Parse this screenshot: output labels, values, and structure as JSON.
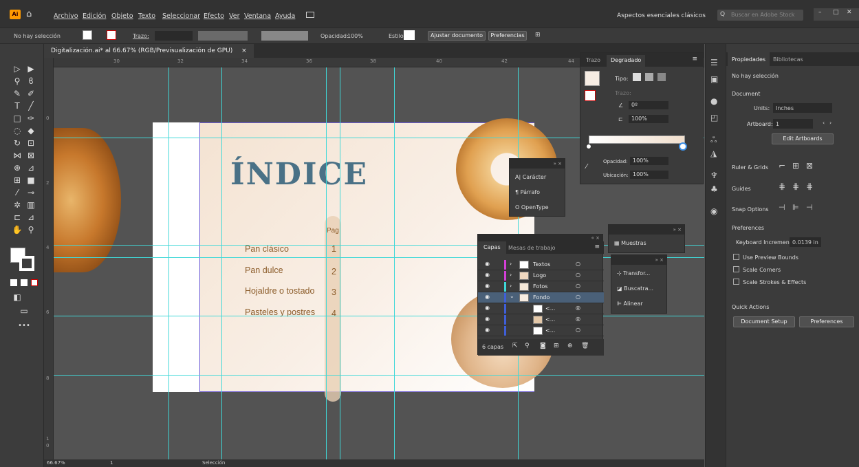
{
  "menubar": {
    "items": [
      "Archivo",
      "Edición",
      "Objeto",
      "Texto",
      "Seleccionar",
      "Efecto",
      "Ver",
      "Ventana",
      "Ayuda"
    ],
    "workspace": "Aspectos esenciales clásicos",
    "search_placeholder": "Buscar en Adobe Stock"
  },
  "control": {
    "selection": "No hay selección",
    "stroke_label": "Trazo:",
    "opacity_label": "Opacidad:",
    "opacity_value": "100%",
    "style_label": "Estilo:",
    "fit_doc": "Ajustar documento",
    "prefs": "Preferencias"
  },
  "document": {
    "tab": "Digitalización.ai* al 66.67% (RGB/Previsualización de GPU)",
    "close": "×"
  },
  "ruler": {
    "h": [
      "30",
      "32",
      "34",
      "36",
      "38",
      "40",
      "42",
      "44"
    ],
    "v": [
      "0",
      "2",
      "4",
      "6",
      "8",
      "1",
      "0"
    ]
  },
  "artboard": {
    "title": "ÍNDICE",
    "pag": "Pag",
    "items": [
      {
        "label": "Pan clásico",
        "num": "1"
      },
      {
        "label": "Pan dulce",
        "num": "2"
      },
      {
        "label": "Hojaldre o tostado",
        "num": "3"
      },
      {
        "label": "Pasteles y postres",
        "num": "4"
      }
    ]
  },
  "gradient_panel": {
    "tab_trazo": "Trazo",
    "tab_degradado": "Degradado",
    "tipo": "Tipo:",
    "trazo": "Trazo:",
    "angle": "0º",
    "aspect": "100%",
    "opacidad_label": "Opacidad:",
    "opacidad": "100%",
    "ubicacion_label": "Ubicación:",
    "ubicacion": "100%"
  },
  "char_panel": {
    "items": [
      "Carácter",
      "Párrafo",
      "OpenType"
    ]
  },
  "swatches_panel": {
    "label": "Muestras"
  },
  "transform_panel": {
    "items": [
      "Transfor...",
      "Buscatra...",
      "Alinear"
    ]
  },
  "layers_panel": {
    "tab_capas": "Capas",
    "tab_mesas": "Mesas de trabajo",
    "layers": [
      {
        "name": "Textos",
        "color": "#d43fd8"
      },
      {
        "name": "Logo",
        "color": "#d43fd8"
      },
      {
        "name": "Fotos",
        "color": "#3fd8d8"
      },
      {
        "name": "Fondo",
        "color": "#3f5fd8"
      },
      {
        "name": "<...",
        "color": "#3f5fd8"
      },
      {
        "name": "<...",
        "color": "#3f5fd8"
      },
      {
        "name": "<...",
        "color": "#3f5fd8"
      }
    ],
    "count": "6 capas"
  },
  "properties": {
    "tab_props": "Propiedades",
    "tab_libs": "Bibliotecas",
    "no_sel": "No hay selección",
    "document": "Document",
    "units_label": "Units:",
    "units": "Inches",
    "artboard_label": "Artboard:",
    "artboard": "1",
    "edit_artboards": "Edit Artboards",
    "ruler_grids": "Ruler & Grids",
    "guides": "Guides",
    "snap": "Snap Options",
    "preferences": "Preferences",
    "keyboard_inc_label": "Keyboard Increment:",
    "keyboard_inc": "0.0139 in",
    "preview_bounds": "Use Preview Bounds",
    "scale_corners": "Scale Corners",
    "scale_strokes": "Scale Strokes & Effects",
    "quick_actions": "Quick Actions",
    "doc_setup": "Document Setup",
    "prefs_btn": "Preferences"
  },
  "status": {
    "zoom": "66.67%",
    "page": "1",
    "mode": "Selección"
  }
}
